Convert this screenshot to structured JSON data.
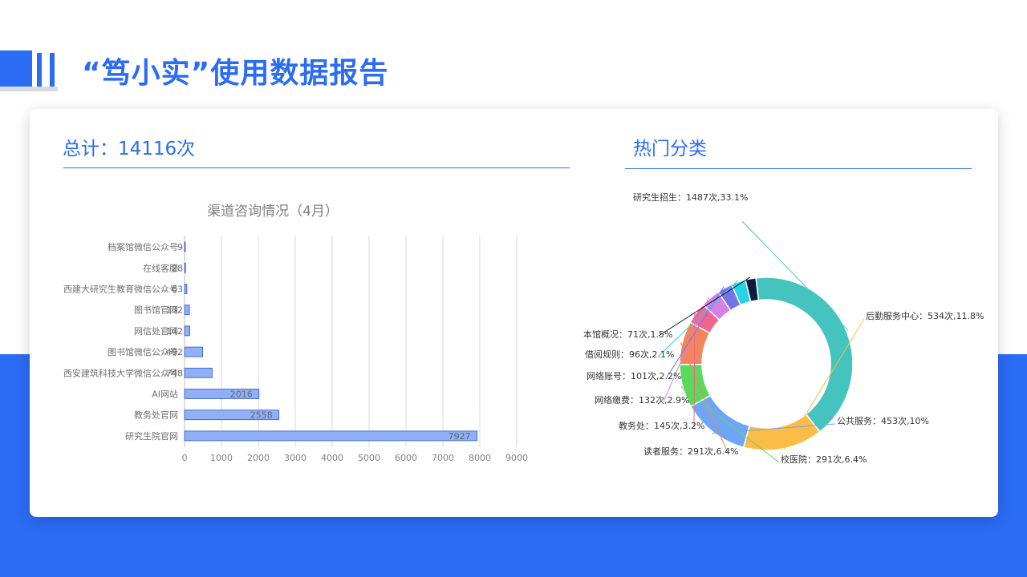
{
  "page": {
    "title": "“笃小实”使用数据报告",
    "total_label": "总计：14116次",
    "hot_label": "热门分类"
  },
  "colors": {
    "brand_blue": "#2b6cf5",
    "bar_fill": "#8fb0f7",
    "bar_stroke": "#2f57c8"
  },
  "chart_data": [
    {
      "type": "bar",
      "orientation": "horizontal",
      "title": "渠道咨询情况（4月）",
      "categories": [
        "档案馆微信公众号",
        "在线客服",
        "西建大研究生教育微信公众号",
        "图书馆官网",
        "网信处官网",
        "图书馆微信公众号",
        "西安建筑科技大学微信公众号",
        "AI网站",
        "教务处官网",
        "研究生院官网"
      ],
      "values": [
        9,
        28,
        63,
        132,
        142,
        492,
        748,
        2016,
        2558,
        7927
      ],
      "xlim": [
        0,
        9000
      ],
      "xticks": [
        "0",
        "1000",
        "2000",
        "3000",
        "4000",
        "5000",
        "6000",
        "7000",
        "8000",
        "9000"
      ],
      "grid": true,
      "legend": "none"
    },
    {
      "type": "pie",
      "style": "donut",
      "slices": [
        {
          "label": "研究生招生",
          "value": 1487,
          "percent": 33.1,
          "text": "研究生招生：1487次,33.1%",
          "color": "#45c4bf"
        },
        {
          "label": "后勤服务中心",
          "value": 534,
          "percent": 11.8,
          "text": "后勤服务中心：534次,11.8%",
          "color": "#fcbc45"
        },
        {
          "label": "公共服务",
          "value": 453,
          "percent": 10,
          "text": "公共服务：453次,10%",
          "color": "#6fa5f7"
        },
        {
          "label": "校医院",
          "value": 291,
          "percent": 6.4,
          "text": "校医院：291次,6.4%",
          "color": "#5bd95a"
        },
        {
          "label": "读者服务",
          "value": 291,
          "percent": 6.4,
          "text": "读者服务：291次,6.4%",
          "color": "#f3855c"
        },
        {
          "label": "教务处",
          "value": 145,
          "percent": 3.2,
          "text": "教务处：145次,3.2%",
          "color": "#f0658e"
        },
        {
          "label": "网络缴费",
          "value": 132,
          "percent": 2.9,
          "text": "网络缴费：132次,2.9%",
          "color": "#d580e6"
        },
        {
          "label": "网络账号",
          "value": 101,
          "percent": 2.2,
          "text": "网络账号：101次,2.2%",
          "color": "#7573e8"
        },
        {
          "label": "借阅规则",
          "value": 96,
          "percent": 2.1,
          "text": "借阅规则：96次,2.1%",
          "color": "#25d3e3"
        },
        {
          "label": "本馆概况",
          "value": 71,
          "percent": 1.5,
          "text": "本馆概况：71次,1.5%",
          "color": "#0d1b40"
        }
      ]
    }
  ]
}
